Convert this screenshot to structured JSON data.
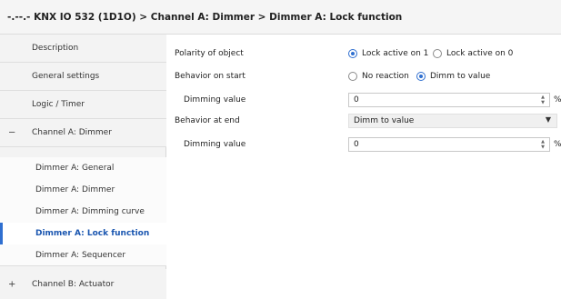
{
  "header": {
    "title": "-.--.- KNX IO 532 (1D1O) > Channel A: Dimmer > Dimmer A: Lock function"
  },
  "sidebar": {
    "items": [
      {
        "label": "Description",
        "prefix": ""
      },
      {
        "label": "General settings",
        "prefix": ""
      },
      {
        "label": "Logic / Timer",
        "prefix": ""
      },
      {
        "label": "Channel A: Dimmer",
        "prefix": "−"
      },
      {
        "label": "Dimmer A: General",
        "prefix": ""
      },
      {
        "label": "Dimmer A: Dimmer",
        "prefix": ""
      },
      {
        "label": "Dimmer A: Dimming curve",
        "prefix": ""
      },
      {
        "label": "Dimmer A: Lock function",
        "prefix": ""
      },
      {
        "label": "Dimmer A: Sequencer",
        "prefix": ""
      },
      {
        "label": "Channel B: Actuator",
        "prefix": "+"
      }
    ]
  },
  "params": {
    "polarity": {
      "label": "Polarity of object",
      "options": [
        "Lock active on 1",
        "Lock active on 0"
      ],
      "selected": 0
    },
    "behavior_start": {
      "label": "Behavior on start",
      "options": [
        "No reaction",
        "Dimm to value"
      ],
      "selected": 1
    },
    "dimming_value_1": {
      "label": "Dimming value",
      "value": "0",
      "unit": "%"
    },
    "behavior_end": {
      "label": "Behavior at end",
      "value": "Dimm to value"
    },
    "dimming_value_2": {
      "label": "Dimming value",
      "value": "0",
      "unit": "%"
    }
  },
  "colors": {
    "accent": "#2f6fd0",
    "sidebar_bg": "#f3f3f3"
  }
}
